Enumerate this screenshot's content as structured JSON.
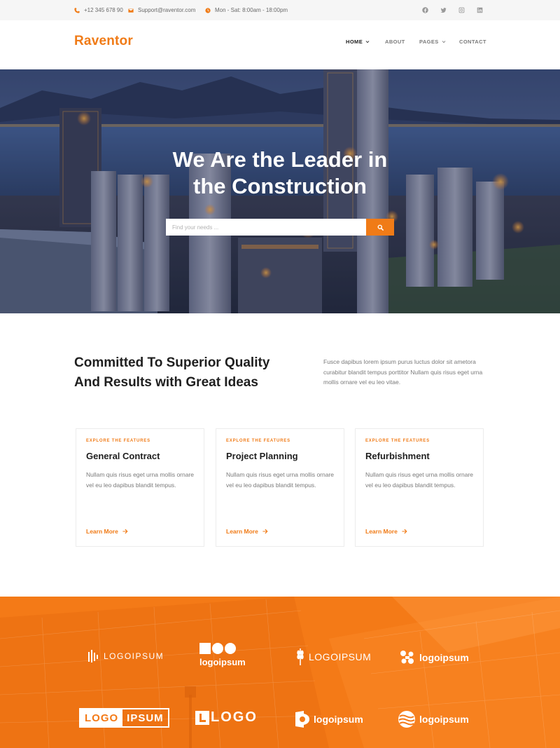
{
  "topbar": {
    "phone": "+12 345 678 90",
    "email": "Support@raventor.com",
    "hours": "Mon - Sat: 8:00am - 18:00pm",
    "social_icons": [
      "facebook-icon",
      "twitter-icon",
      "instagram-icon",
      "linkedin-icon"
    ]
  },
  "header": {
    "logo": "Raventor",
    "nav": [
      {
        "label": "HOME",
        "active": true,
        "dropdown": true
      },
      {
        "label": "ABOUT",
        "active": false,
        "dropdown": false
      },
      {
        "label": "PAGES",
        "active": false,
        "dropdown": true
      },
      {
        "label": "CONTACT",
        "active": false,
        "dropdown": false
      }
    ]
  },
  "hero": {
    "title_line1": "We Are the Leader in",
    "title_line2": "the Construction",
    "search_placeholder": "Find your needs ..."
  },
  "intro": {
    "title_line1": "Committed To Superior Quality",
    "title_line2": "And Results with Great Ideas",
    "text": "Fusce dapibus lorem ipsum purus luctus dolor sit ametora curabitur blandit tempus porttitor Nullam quis risus eget urna mollis ornare vel eu leo vitae."
  },
  "cards": [
    {
      "eyebrow": "EXPLORE THE FEATURES",
      "title": "General Contract",
      "text": "Nullam quis risus eget urna mollis ornare vel eu leo dapibus blandit tempus.",
      "link": "Learn More"
    },
    {
      "eyebrow": "EXPLORE THE FEATURES",
      "title": "Project Planning",
      "text": "Nullam quis risus eget urna mollis ornare vel eu leo dapibus blandit tempus.",
      "link": "Learn More"
    },
    {
      "eyebrow": "EXPLORE THE FEATURES",
      "title": "Refurbishment",
      "text": "Nullam quis risus eget urna mollis ornare vel eu leo dapibus blandit tempus.",
      "link": "Learn More"
    }
  ],
  "partners": {
    "logo1": "LOGOIPSUM",
    "logo2": "logoipsum",
    "logo3": "LOGOIPSUM",
    "logo4": "logoipsum",
    "logo5_left": "LOGO",
    "logo5_right": "IPSUM",
    "logo6": "LOGO",
    "logo7": "logoipsum",
    "logo8": "logoipsum"
  },
  "colors": {
    "accent": "#f07b17",
    "band": "#f47a17",
    "text_dark": "#1f1f1f",
    "text_muted": "#7a7a7a"
  }
}
